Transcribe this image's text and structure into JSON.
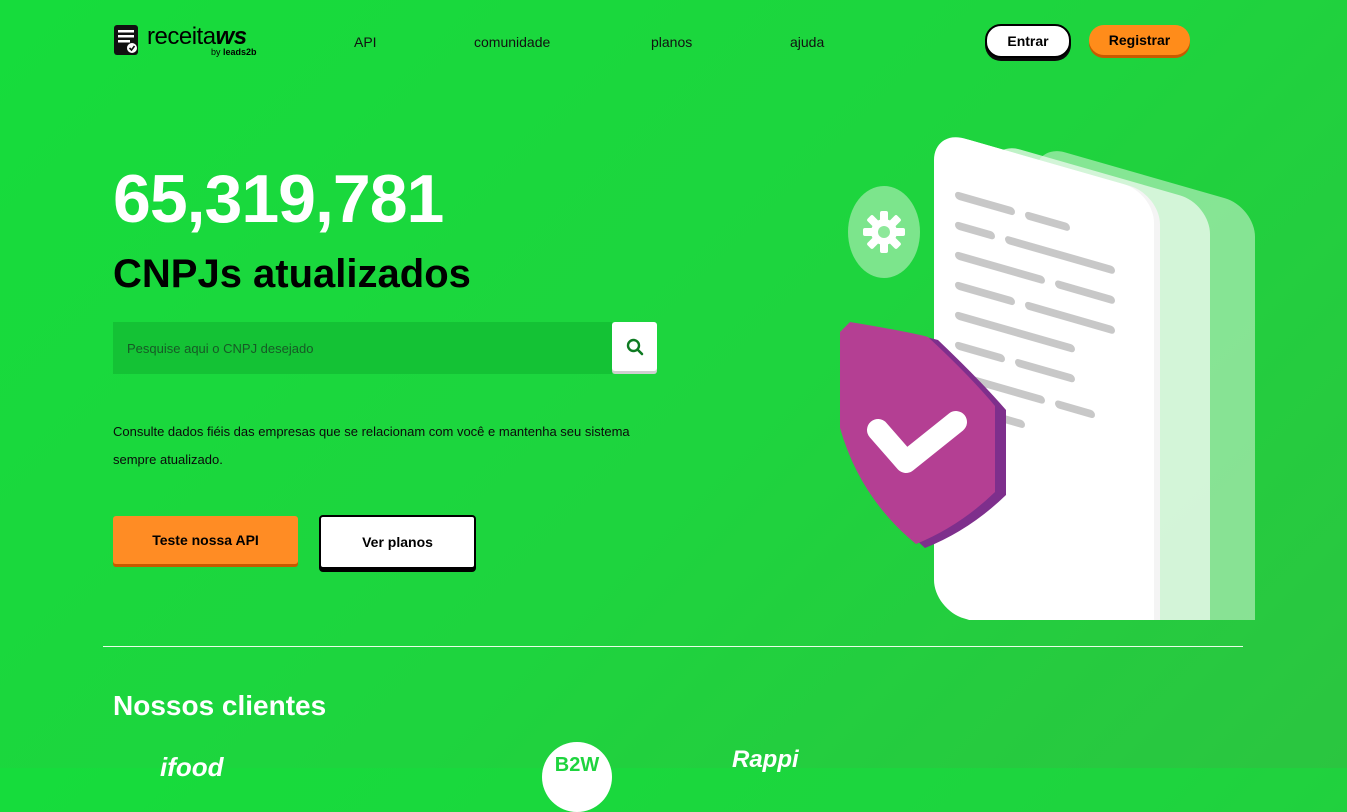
{
  "header": {
    "logo_text_plain": "receita",
    "logo_text_bold": "ws",
    "logo_by": "by",
    "logo_by_brand": "leads2b",
    "nav": [
      {
        "label": "API"
      },
      {
        "label": "comunidade"
      },
      {
        "label": "planos"
      },
      {
        "label": "ajuda"
      }
    ],
    "login_label": "Entrar",
    "register_label": "Registrar"
  },
  "hero": {
    "count": "65,319,781",
    "subtitle": "CNPJs atualizados",
    "search_placeholder": "Pesquise aqui o CNPJ desejado",
    "search_icon": "search-icon",
    "description": "Consulte dados fiéis das empresas que se relacionam com você e mantenha seu sistema sempre atualizado.",
    "cta_primary": "Teste nossa API",
    "cta_secondary": "Ver planos"
  },
  "clients": {
    "title": "Nossos clientes",
    "logos": [
      "ifood",
      "B2W",
      "Rappi"
    ]
  },
  "colors": {
    "background": "#1ed43e",
    "accent_orange": "#ff8c1a",
    "shield_purple": "#b03d8f"
  }
}
